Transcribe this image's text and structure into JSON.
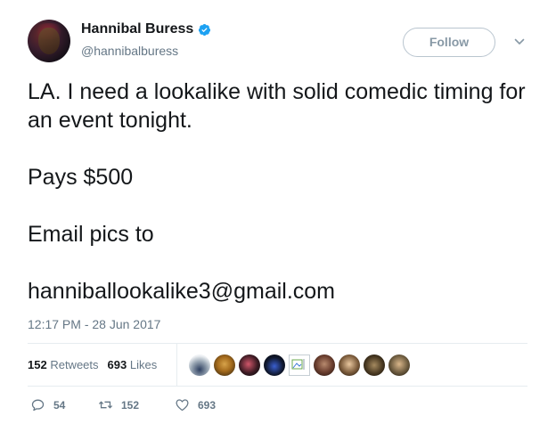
{
  "user": {
    "display_name": "Hannibal Buress",
    "handle": "@hannibalburess",
    "verified": true
  },
  "follow_button": {
    "label": "Follow"
  },
  "tweet": {
    "lines": [
      "LA. I need a lookalike with solid comedic timing for an event tonight.",
      "Pays $500",
      "Email pics to",
      "hanniballookalike3@gmail.com"
    ],
    "timestamp": "12:17 PM - 28 Jun 2017"
  },
  "stats": {
    "retweets_count": "152",
    "retweets_label": "Retweets",
    "likes_count": "693",
    "likes_label": "Likes"
  },
  "actions": {
    "reply_count": "54",
    "retweet_count": "152",
    "like_count": "693"
  },
  "icons": {
    "verified": "verified-badge-icon",
    "caret": "chevron-down-icon",
    "reply": "reply-icon",
    "retweet": "retweet-icon",
    "like": "heart-icon"
  },
  "colors": {
    "verified_blue": "#1da1f2",
    "text_primary": "#14171a",
    "text_secondary": "#657786",
    "divider": "#e6ecf0"
  }
}
